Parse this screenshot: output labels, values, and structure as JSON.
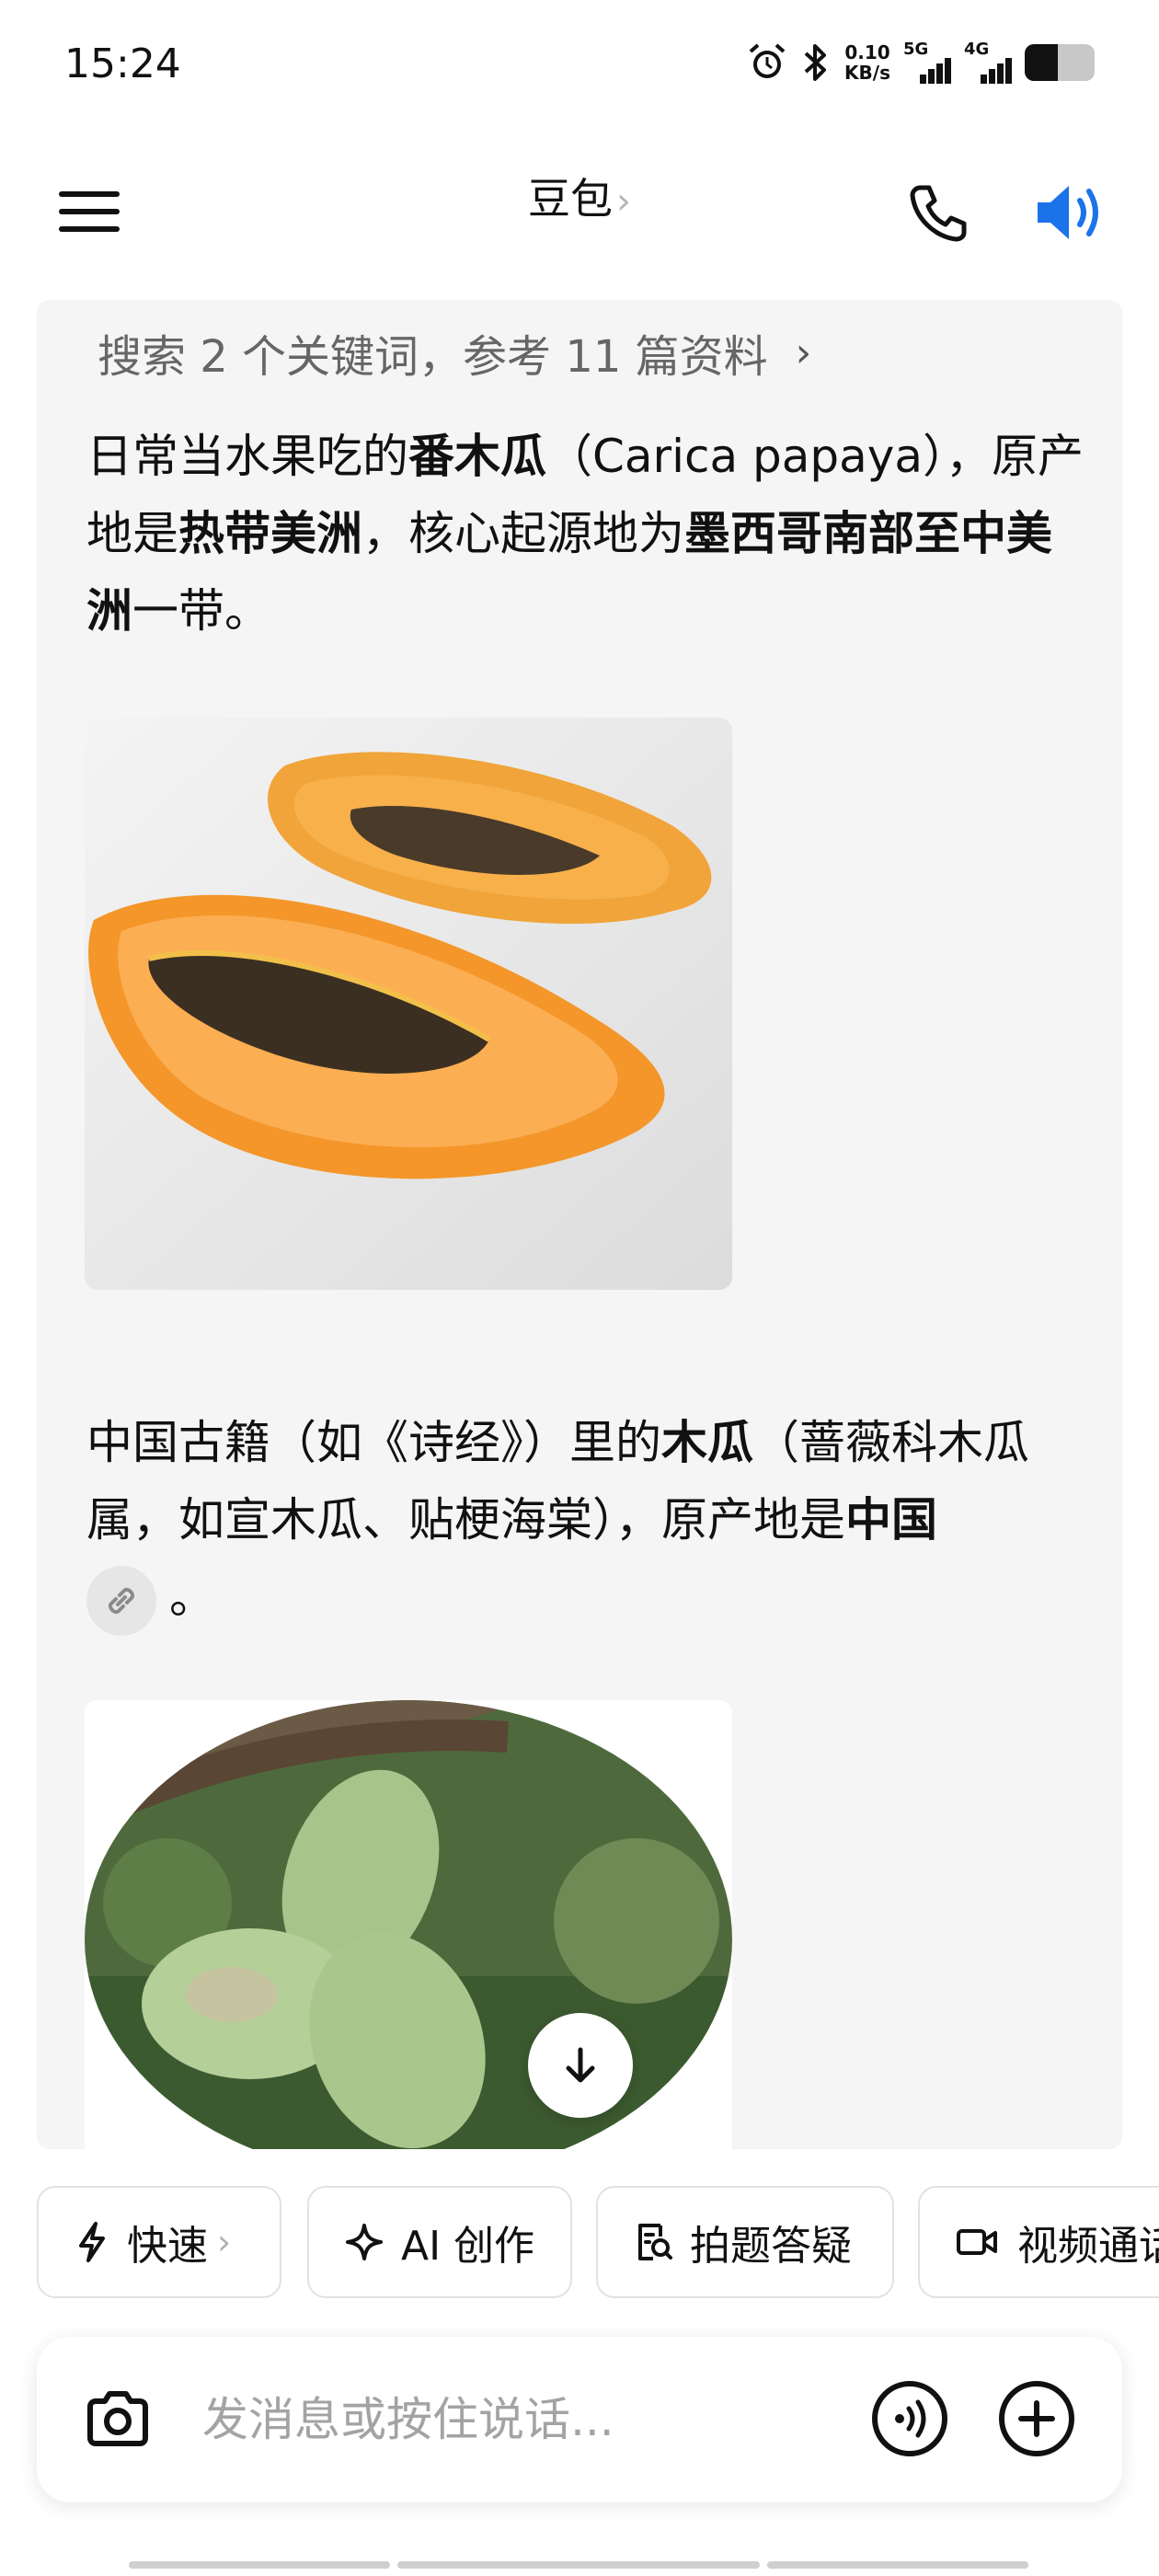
{
  "status_bar": {
    "time": "15:24",
    "net_speed_value": "0.10",
    "net_speed_unit": "KB/s",
    "signal_1_label": "5G",
    "signal_2_label": "4G",
    "battery_level": 0.48
  },
  "header": {
    "title": "豆包",
    "title_chevron": "›"
  },
  "chat": {
    "search_summary": "搜索 2 个关键词，参考 11 篇资料",
    "search_chevron": "›",
    "paragraph1": {
      "t1": "日常当水果吃的",
      "b1": "番木瓜",
      "t2": "（Carica papaya），原产地是",
      "b2": "热带美洲",
      "t3": "，核心起源地为",
      "b3": "墨西哥南部至中美洲",
      "t4": "一带。"
    },
    "paragraph2": {
      "t1": "中国古籍（如《诗经》）里的",
      "b1": "木瓜",
      "t2": "（蔷薇科木瓜属，如宣木瓜、贴梗海棠），原产地是",
      "b2": "中国",
      "t3": "。"
    }
  },
  "chips": [
    {
      "label": "快速",
      "chevron": "›",
      "icon": "lightning-icon"
    },
    {
      "label": "AI 创作",
      "icon": "sparkle-icon"
    },
    {
      "label": "拍题答疑",
      "icon": "doc-search-icon"
    },
    {
      "label": "视频通话",
      "icon": "video-icon"
    }
  ],
  "input": {
    "placeholder": "发消息或按住说话..."
  },
  "colors": {
    "accent_blue": "#1a73e8",
    "papaya_orange": "#f59a2e",
    "chat_bg": "#f5f5f5"
  }
}
